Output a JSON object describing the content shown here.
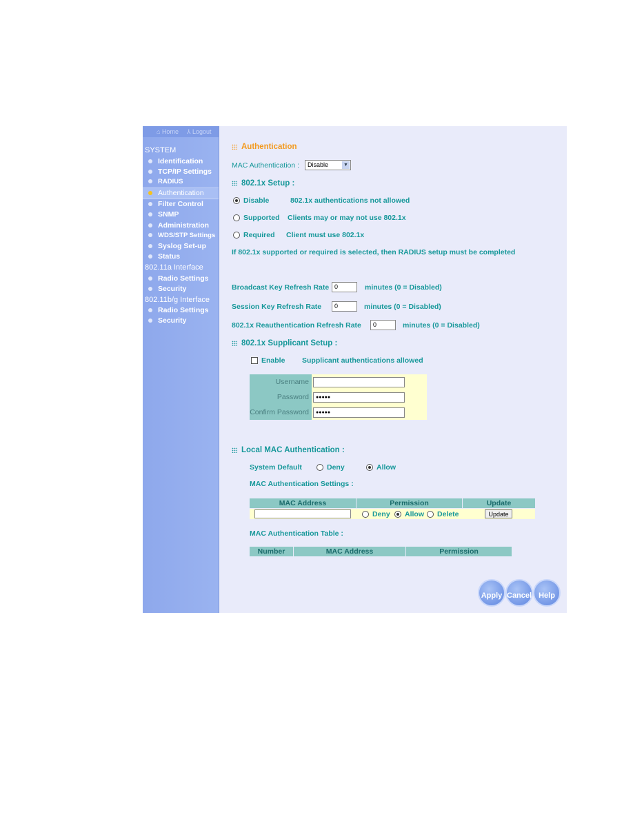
{
  "nav": {
    "home": "Home",
    "logout": "Logout"
  },
  "sidebar": {
    "system": "SYSTEM",
    "system_items": [
      "Identification",
      "TCP/IP Settings",
      "RADIUS",
      "Authentication",
      "Filter Control",
      "SNMP",
      "Administration",
      "WDS/STP Settings",
      "Syslog Set-up",
      "Status"
    ],
    "a_head": "802.11a Interface",
    "a_items": [
      "Radio Settings",
      "Security"
    ],
    "bg_head": "802.11b/g Interface",
    "bg_items": [
      "Radio Settings",
      "Security"
    ],
    "active": "Authentication"
  },
  "main": {
    "title": "Authentication",
    "mac_auth_label": "MAC Authentication :",
    "mac_auth_value": "Disable",
    "setup_title": "802.1x Setup :",
    "setup_options": [
      {
        "label": "Disable",
        "desc": "802.1x authentications not allowed",
        "selected": true
      },
      {
        "label": "Supported",
        "desc": "Clients may or may not use 802.1x",
        "selected": false
      },
      {
        "label": "Required",
        "desc": "Client must use 802.1x",
        "selected": false
      }
    ],
    "note": "If 802.1x supported or required is selected, then RADIUS setup must be completed",
    "rates": [
      {
        "label": "Broadcast Key Refresh Rate",
        "value": "0",
        "unit": "minutes  (0 = Disabled)"
      },
      {
        "label": "Session Key Refresh Rate",
        "value": "0",
        "unit": "minutes  (0 = Disabled)"
      },
      {
        "label": "802.1x Reauthentication Refresh Rate",
        "value": "0",
        "unit": "minutes  (0 = Disabled)"
      }
    ],
    "supplicant_title": "802.1x Supplicant Setup :",
    "enable_label": "Enable",
    "enable_desc": "Supplicant authentications allowed",
    "enable_checked": false,
    "fields": [
      {
        "label": "Username",
        "value": ""
      },
      {
        "label": "Password",
        "value": "●●●●●"
      },
      {
        "label": "Confirm Password",
        "value": "●●●●●"
      }
    ],
    "local_title": "Local MAC Authentication :",
    "system_default_label": "System Default",
    "deny": "Deny",
    "allow": "Allow",
    "delete": "Delete",
    "system_default": "Allow",
    "settings_label": "MAC Authentication Settings :",
    "settings_headers": [
      "MAC Address",
      "Permission",
      "Update"
    ],
    "mac_value": "",
    "permission": "Allow",
    "update_button": "Update",
    "table_label": "MAC Authentication Table :",
    "table_headers": [
      "Number",
      "MAC Address",
      "Permission"
    ]
  },
  "buttons": {
    "apply": "Apply",
    "cancel": "Cancel",
    "help": "Help"
  },
  "colors": {
    "text": "#17989a",
    "title": "#f39a1e",
    "sidebar": "#8ea8ec",
    "header_cell": "#8cc8c4",
    "row_bg": "#ffffd0"
  }
}
